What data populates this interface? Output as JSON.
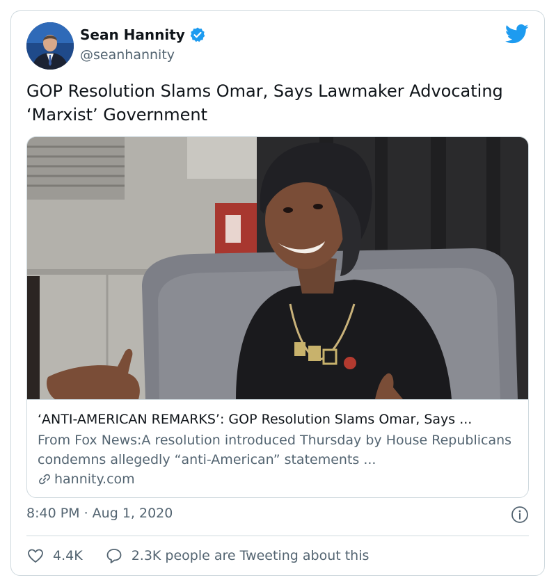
{
  "author": {
    "name": "Sean Hannity",
    "handle": "@seanhannity",
    "verified": true
  },
  "tweet": {
    "text": "GOP Resolution Slams Omar, Says Lawmaker Advocating ‘Marxist’ Government"
  },
  "link_card": {
    "title": "‘ANTI-AMERICAN REMARKS’: GOP Resolution Slams Omar, Says ...",
    "description": "From Fox News:A resolution introduced Thursday by House Republicans condemns allegedly “anti-American” statements ...",
    "domain": "hannity.com"
  },
  "meta": {
    "timestamp": "8:40 PM · Aug 1, 2020"
  },
  "actions": {
    "likes": "4.4K",
    "tweeting": "2.3K people are Tweeting about this"
  },
  "icons": {
    "verified": "verified-badge-icon",
    "brand": "twitter-bird-icon",
    "link": "link-icon",
    "info": "info-icon",
    "like": "heart-icon",
    "reply": "speech-bubble-icon"
  },
  "colors": {
    "brand_blue": "#1d9bf0",
    "text_primary": "#0f1419",
    "text_secondary": "#536471",
    "border": "#cfd9de"
  }
}
